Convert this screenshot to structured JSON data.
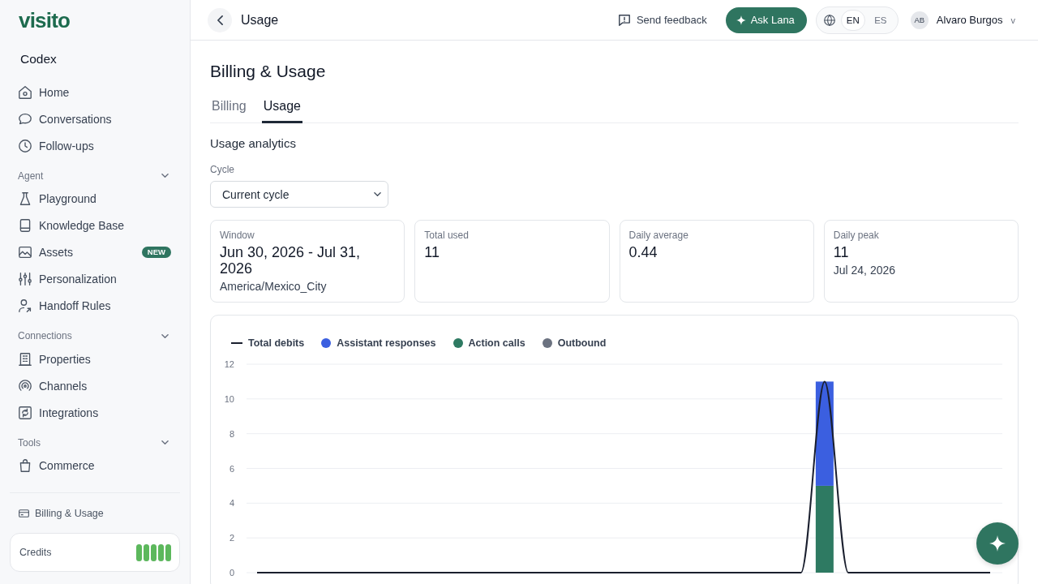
{
  "sidebar": {
    "logo": "visito",
    "workspace": "Codex",
    "sections": [
      {
        "items": [
          {
            "label": "Home",
            "selected": false
          },
          {
            "label": "Conversations",
            "selected": false
          },
          {
            "label": "Follow-ups",
            "selected": false
          }
        ]
      },
      {
        "title": "Agent",
        "expanded": true,
        "items": [
          {
            "label": "Playground",
            "selected": false
          },
          {
            "label": "Knowledge Base",
            "selected": false
          },
          {
            "label": "Assets",
            "selected": false,
            "badge": "NEW"
          },
          {
            "label": "Personalization",
            "selected": false
          },
          {
            "label": "Handoff Rules",
            "selected": false
          }
        ]
      },
      {
        "title": "Connections",
        "expanded": true,
        "items": [
          {
            "label": "Properties",
            "selected": false
          },
          {
            "label": "Channels",
            "selected": false
          },
          {
            "label": "Integrations",
            "selected": false
          }
        ]
      },
      {
        "title": "Tools",
        "expanded": true,
        "items": [
          {
            "label": "Commerce",
            "selected": false
          }
        ]
      }
    ],
    "footer_link": "Billing & Usage",
    "credits": {
      "label": "Credits",
      "level": 1
    }
  },
  "topbar": {
    "title": "Usage",
    "feedback": "Send feedback",
    "ask_button": "Ask Lana",
    "languages": [
      {
        "label": "EN",
        "selected": true
      },
      {
        "label": "ES",
        "selected": false
      }
    ],
    "user": {
      "initials": "AB",
      "name": "Alvaro Burgos",
      "caret": "v"
    }
  },
  "page": {
    "title": "Billing & Usage",
    "tabs": [
      {
        "label": "Billing",
        "selected": false
      },
      {
        "label": "Usage",
        "selected": true
      }
    ],
    "section_title": "Usage analytics",
    "cycle": {
      "label": "Cycle",
      "value": "Current cycle"
    },
    "stats": [
      {
        "label": "Window",
        "value": "Jun 30, 2026 - Jul 31, 2026",
        "note": "America/Mexico_City"
      },
      {
        "label": "Total used",
        "value": "11"
      },
      {
        "label": "Daily average",
        "value": "0.44"
      },
      {
        "label": "Daily peak",
        "value": "11",
        "note": "Jul 24, 2026"
      }
    ],
    "chart_data": [
      {
        "type": "bar",
        "stacked": true,
        "legend": "top-left",
        "grid": true,
        "ylim": [
          0,
          12
        ],
        "yticks": [
          0,
          2,
          4,
          6,
          8,
          10,
          12
        ],
        "categories": [
          null,
          null,
          null,
          null,
          null,
          null,
          null,
          null,
          null,
          null,
          null,
          null,
          null,
          null,
          null,
          null,
          null,
          null,
          null,
          null,
          null,
          null,
          null,
          null,
          null,
          null,
          null,
          null,
          null,
          null,
          null,
          null
        ],
        "series": [
          {
            "name": "Total debits",
            "type": "line",
            "color": "#1a1f2e",
            "values": [
              0,
              0,
              0,
              0,
              0,
              0,
              0,
              0,
              0,
              0,
              0,
              0,
              0,
              0,
              0,
              0,
              0,
              0,
              0,
              0,
              0,
              0,
              0,
              0,
              11,
              0,
              0,
              0,
              0,
              0,
              0,
              0
            ]
          },
          {
            "name": "Assistant responses",
            "color": "#3b5fe0",
            "values": [
              0,
              0,
              0,
              0,
              0,
              0,
              0,
              0,
              0,
              0,
              0,
              0,
              0,
              0,
              0,
              0,
              0,
              0,
              0,
              0,
              0,
              0,
              0,
              0,
              6,
              0,
              0,
              0,
              0,
              0,
              0,
              0
            ]
          },
          {
            "name": "Action calls",
            "color": "#2e7a62",
            "values": [
              0,
              0,
              0,
              0,
              0,
              0,
              0,
              0,
              0,
              0,
              0,
              0,
              0,
              0,
              0,
              0,
              0,
              0,
              0,
              0,
              0,
              0,
              0,
              0,
              5,
              0,
              0,
              0,
              0,
              0,
              0,
              0
            ]
          },
          {
            "name": "Outbound",
            "color": "#6b7280",
            "values": [
              0,
              0,
              0,
              0,
              0,
              0,
              0,
              0,
              0,
              0,
              0,
              0,
              0,
              0,
              0,
              0,
              0,
              0,
              0,
              0,
              0,
              0,
              0,
              0,
              0,
              0,
              0,
              0,
              0,
              0,
              0,
              0
            ]
          }
        ]
      }
    ]
  }
}
